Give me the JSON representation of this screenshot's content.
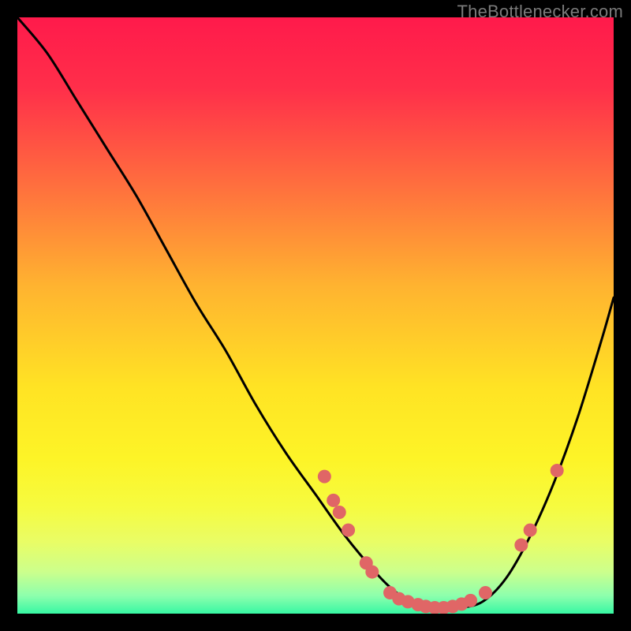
{
  "attribution": "TheBottlenecker.com",
  "chart_data": {
    "type": "line",
    "title": "",
    "xlabel": "",
    "ylabel": "",
    "xlim": [
      0,
      100
    ],
    "ylim": [
      0,
      100
    ],
    "grid": false,
    "series": [
      {
        "name": "bottleneck-curve",
        "x": [
          0,
          5,
          10,
          15,
          20,
          25,
          30,
          35,
          40,
          45,
          50,
          55,
          60,
          63,
          66,
          70,
          74,
          78,
          82,
          86,
          90,
          94,
          98,
          100
        ],
        "y": [
          100,
          94,
          86,
          78,
          70,
          61,
          52,
          44,
          35,
          27,
          20,
          13,
          7,
          4,
          2,
          1,
          1,
          2,
          6,
          13,
          22,
          33,
          46,
          53
        ]
      }
    ],
    "markers": [
      {
        "x": 51.5,
        "y": 23.0
      },
      {
        "x": 53.0,
        "y": 19.0
      },
      {
        "x": 54.0,
        "y": 17.0
      },
      {
        "x": 55.5,
        "y": 14.0
      },
      {
        "x": 58.5,
        "y": 8.5
      },
      {
        "x": 59.5,
        "y": 7.0
      },
      {
        "x": 62.5,
        "y": 3.5
      },
      {
        "x": 64.0,
        "y": 2.5
      },
      {
        "x": 65.5,
        "y": 2.0
      },
      {
        "x": 67.2,
        "y": 1.5
      },
      {
        "x": 68.5,
        "y": 1.2
      },
      {
        "x": 70.0,
        "y": 1.0
      },
      {
        "x": 71.5,
        "y": 1.0
      },
      {
        "x": 73.0,
        "y": 1.2
      },
      {
        "x": 74.5,
        "y": 1.6
      },
      {
        "x": 76.0,
        "y": 2.2
      },
      {
        "x": 78.5,
        "y": 3.5
      },
      {
        "x": 84.5,
        "y": 11.5
      },
      {
        "x": 86.0,
        "y": 14.0
      },
      {
        "x": 90.5,
        "y": 24.0
      }
    ],
    "gradient_stops": [
      {
        "pos": 0.0,
        "color": "#ff1a4b"
      },
      {
        "pos": 0.12,
        "color": "#ff2f4a"
      },
      {
        "pos": 0.28,
        "color": "#ff6e3e"
      },
      {
        "pos": 0.45,
        "color": "#ffb330"
      },
      {
        "pos": 0.62,
        "color": "#ffe324"
      },
      {
        "pos": 0.74,
        "color": "#fdf427"
      },
      {
        "pos": 0.82,
        "color": "#f6fb3f"
      },
      {
        "pos": 0.88,
        "color": "#e9fd66"
      },
      {
        "pos": 0.93,
        "color": "#ccff8c"
      },
      {
        "pos": 0.97,
        "color": "#8dffad"
      },
      {
        "pos": 1.0,
        "color": "#37f7a3"
      }
    ],
    "marker_color": "#e06666",
    "curve_color": "#000000"
  }
}
